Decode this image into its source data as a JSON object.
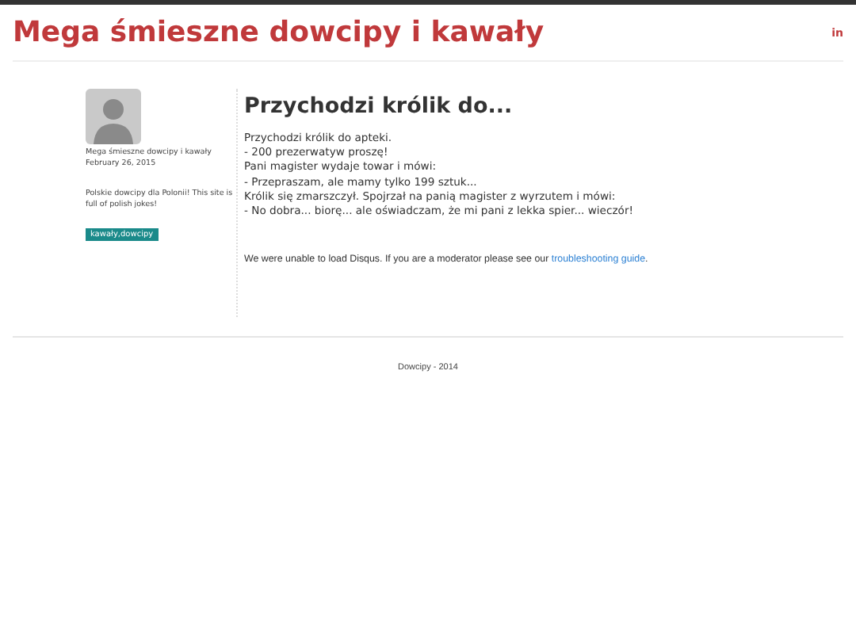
{
  "header": {
    "title": "Mega śmieszne dowcipy i kawały",
    "social_link": "in"
  },
  "sidebar": {
    "author": "Mega śmieszne dowcipy i kawały",
    "date": "February 26, 2015",
    "description": "Polskie dowcipy dla Polonii! This site is full of polish jokes!",
    "tags": [
      "kawały,dowcipy"
    ]
  },
  "post": {
    "title": "Przychodzi królik do...",
    "lines": [
      "Przychodzi królik do apteki.",
      "- 200 prezerwatyw proszę!",
      "Pani magister wydaje towar i mówi:",
      "- Przepraszam, ale mamy tylko 199 sztuk...",
      "Królik się zmarszczył. Spojrzał na panią magister z wyrzutem i mówi:",
      "- No dobra... biorę... ale oświadczam, że mi pani z lekka spier... wieczór!"
    ]
  },
  "disqus": {
    "message": "We were unable to load Disqus. If you are a moderator please see our ",
    "link": "troubleshooting guide",
    "end": "."
  },
  "footer": {
    "text": "Dowcipy - 2014"
  }
}
